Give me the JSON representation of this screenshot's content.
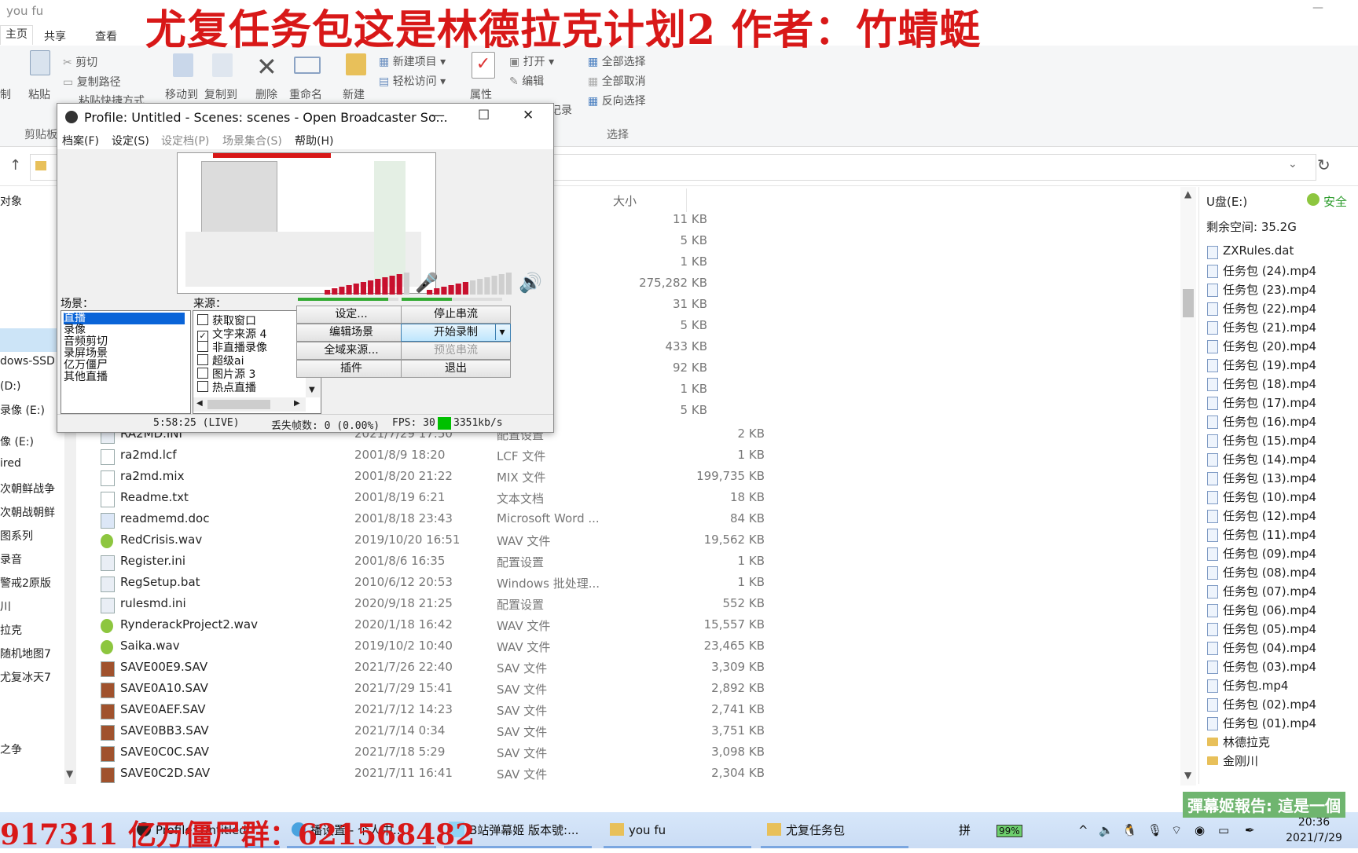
{
  "explorer": {
    "window_title": "you fu",
    "ribbon_tabs": [
      "主页",
      "共享",
      "查看"
    ],
    "clipboard": {
      "copy_label": "制",
      "paste_label": "粘贴",
      "cut_label": "剪切",
      "copy_path_label": "复制路径",
      "paste_shortcut_label": "粘贴快捷方式",
      "group_label": "剪贴板"
    },
    "organize": {
      "move_to": "移动到",
      "copy_to": "复制到",
      "delete": "删除",
      "rename": "重命名"
    },
    "new": {
      "new_folder": "新建",
      "new_item": "新建项目",
      "easy_access": "轻松访问"
    },
    "open": {
      "properties": "属性",
      "open": "打开",
      "edit": "编辑",
      "history": "记录"
    },
    "select": {
      "select_all": "全部选择",
      "select_none": "全部取消",
      "invert": "反向选择",
      "group_label": "选择"
    },
    "column_size": "大小",
    "nav_items": [
      "对象",
      "dows-SSD",
      "(D:)",
      "录像 (E:)",
      "像 (E:)",
      "ired",
      "次朝鲜战争",
      "次朝战朝鲜",
      "图系列",
      "录音",
      "警戒2原版",
      "川",
      "拉克",
      "随机地图7",
      "尤复冰天7",
      "之争"
    ],
    "size_only": [
      "11 KB",
      "5 KB",
      "1 KB",
      "275,282 KB",
      "31 KB",
      "5 KB",
      "433 KB",
      "92 KB",
      "1 KB",
      "5 KB"
    ],
    "files": [
      {
        "name": "RA2MD.INI",
        "date": "2021/7/29 17:50",
        "type": "配置设置",
        "size": "2 KB",
        "icon": "ini"
      },
      {
        "name": "ra2md.lcf",
        "date": "2001/8/9 18:20",
        "type": "LCF 文件",
        "size": "1 KB",
        "icon": "file"
      },
      {
        "name": "ra2md.mix",
        "date": "2001/8/20 21:22",
        "type": "MIX 文件",
        "size": "199,735 KB",
        "icon": "file"
      },
      {
        "name": "Readme.txt",
        "date": "2001/8/19 6:21",
        "type": "文本文档",
        "size": "18 KB",
        "icon": "txt"
      },
      {
        "name": "readmemd.doc",
        "date": "2001/8/18 23:43",
        "type": "Microsoft Word ...",
        "size": "84 KB",
        "icon": "doc"
      },
      {
        "name": "RedCrisis.wav",
        "date": "2019/10/20 16:51",
        "type": "WAV 文件",
        "size": "19,562 KB",
        "icon": "wav"
      },
      {
        "name": "Register.ini",
        "date": "2001/8/6 16:35",
        "type": "配置设置",
        "size": "1 KB",
        "icon": "ini"
      },
      {
        "name": "RegSetup.bat",
        "date": "2010/6/12 20:53",
        "type": "Windows 批处理...",
        "size": "1 KB",
        "icon": "bat"
      },
      {
        "name": "rulesmd.ini",
        "date": "2020/9/18 21:25",
        "type": "配置设置",
        "size": "552 KB",
        "icon": "ini"
      },
      {
        "name": "RynderackProject2.wav",
        "date": "2020/1/18 16:42",
        "type": "WAV 文件",
        "size": "15,557 KB",
        "icon": "wav"
      },
      {
        "name": "Saika.wav",
        "date": "2019/10/2 10:40",
        "type": "WAV 文件",
        "size": "23,465 KB",
        "icon": "wav"
      },
      {
        "name": "SAVE00E9.SAV",
        "date": "2021/7/26 22:40",
        "type": "SAV 文件",
        "size": "3,309 KB",
        "icon": "sav"
      },
      {
        "name": "SAVE0A10.SAV",
        "date": "2021/7/29 15:41",
        "type": "SAV 文件",
        "size": "2,892 KB",
        "icon": "sav"
      },
      {
        "name": "SAVE0AEF.SAV",
        "date": "2021/7/12 14:23",
        "type": "SAV 文件",
        "size": "2,741 KB",
        "icon": "sav"
      },
      {
        "name": "SAVE0BB3.SAV",
        "date": "2021/7/14 0:34",
        "type": "SAV 文件",
        "size": "3,751 KB",
        "icon": "sav"
      },
      {
        "name": "SAVE0C0C.SAV",
        "date": "2021/7/18 5:29",
        "type": "SAV 文件",
        "size": "3,098 KB",
        "icon": "sav"
      },
      {
        "name": "SAVE0C2D.SAV",
        "date": "2021/7/11 16:41",
        "type": "SAV 文件",
        "size": "2,304 KB",
        "icon": "sav"
      }
    ],
    "preview": {
      "drive": "U盘(E:)",
      "safe": "安全",
      "free_space": "剩余空间: 35.2G",
      "items": [
        "ZXRules.dat",
        "任务包 (24).mp4",
        "任务包 (23).mp4",
        "任务包 (22).mp4",
        "任务包 (21).mp4",
        "任务包 (20).mp4",
        "任务包 (19).mp4",
        "任务包 (18).mp4",
        "任务包 (17).mp4",
        "任务包 (16).mp4",
        "任务包 (15).mp4",
        "任务包 (14).mp4",
        "任务包 (13).mp4",
        "任务包 (10).mp4",
        "任务包 (12).mp4",
        "任务包 (11).mp4",
        "任务包 (09).mp4",
        "任务包 (08).mp4",
        "任务包 (07).mp4",
        "任务包 (06).mp4",
        "任务包 (05).mp4",
        "任务包 (04).mp4",
        "任务包 (03).mp4",
        "任务包.mp4",
        "任务包 (02).mp4",
        "任务包 (01).mp4"
      ],
      "folders": [
        "林德拉克",
        "金刚川"
      ]
    }
  },
  "obs": {
    "title": "Profile: Untitled - Scenes: scenes - Open Broadcaster So...",
    "menu": [
      "档案(F)",
      "设定(S)",
      "设定档(P)",
      "场景集合(S)",
      "帮助(H)"
    ],
    "scenes_label": "场景：",
    "sources_label": "来源：",
    "scenes": [
      "直播",
      "录像",
      "音频剪切",
      "录屏场景",
      "亿万僵尸",
      "其他直播"
    ],
    "sources": [
      {
        "label": "获取窗口",
        "checked": false
      },
      {
        "label": "文字来源 4",
        "checked": true
      },
      {
        "label": "非直播录像",
        "checked": false
      },
      {
        "label": "超级ai",
        "checked": false
      },
      {
        "label": "图片源 3",
        "checked": false
      },
      {
        "label": "热点直播",
        "checked": false
      }
    ],
    "buttons": {
      "settings": "设定...",
      "stop_stream": "停止串流",
      "edit_scene": "编辑场景",
      "start_record": "开始录制",
      "global_sources": "全域来源...",
      "preview_stream": "预览串流",
      "plugins": "插件",
      "exit": "退出"
    },
    "status": {
      "time": "5:58:25 (LIVE)",
      "dropped": "丢失帧数: 0 (0.00%)",
      "fps": "FPS: 30",
      "bitrate": "3351kb/s"
    },
    "mic_level": 0.9,
    "desktop_level": 0.5
  },
  "overlays": {
    "title": "尤复任务包这是林德拉克计划2 作者：竹蜻蜓",
    "bottom_left": "917311 亿万僵尸群：621568482",
    "bottom_right": "彈幕姬報告: 這是一個"
  },
  "taskbar": {
    "items": [
      "Profile: Untitled",
      "播设置 - 个人中...",
      "B站弹幕姬 版本號:...",
      "you fu",
      "尤复任务包"
    ],
    "ime": "拼",
    "battery": "99%",
    "time": "20:36",
    "date": "2021/7/29"
  },
  "colors": {
    "accent_red": "#d81818",
    "live_green": "#00c000",
    "selection": "#0a64d8"
  }
}
